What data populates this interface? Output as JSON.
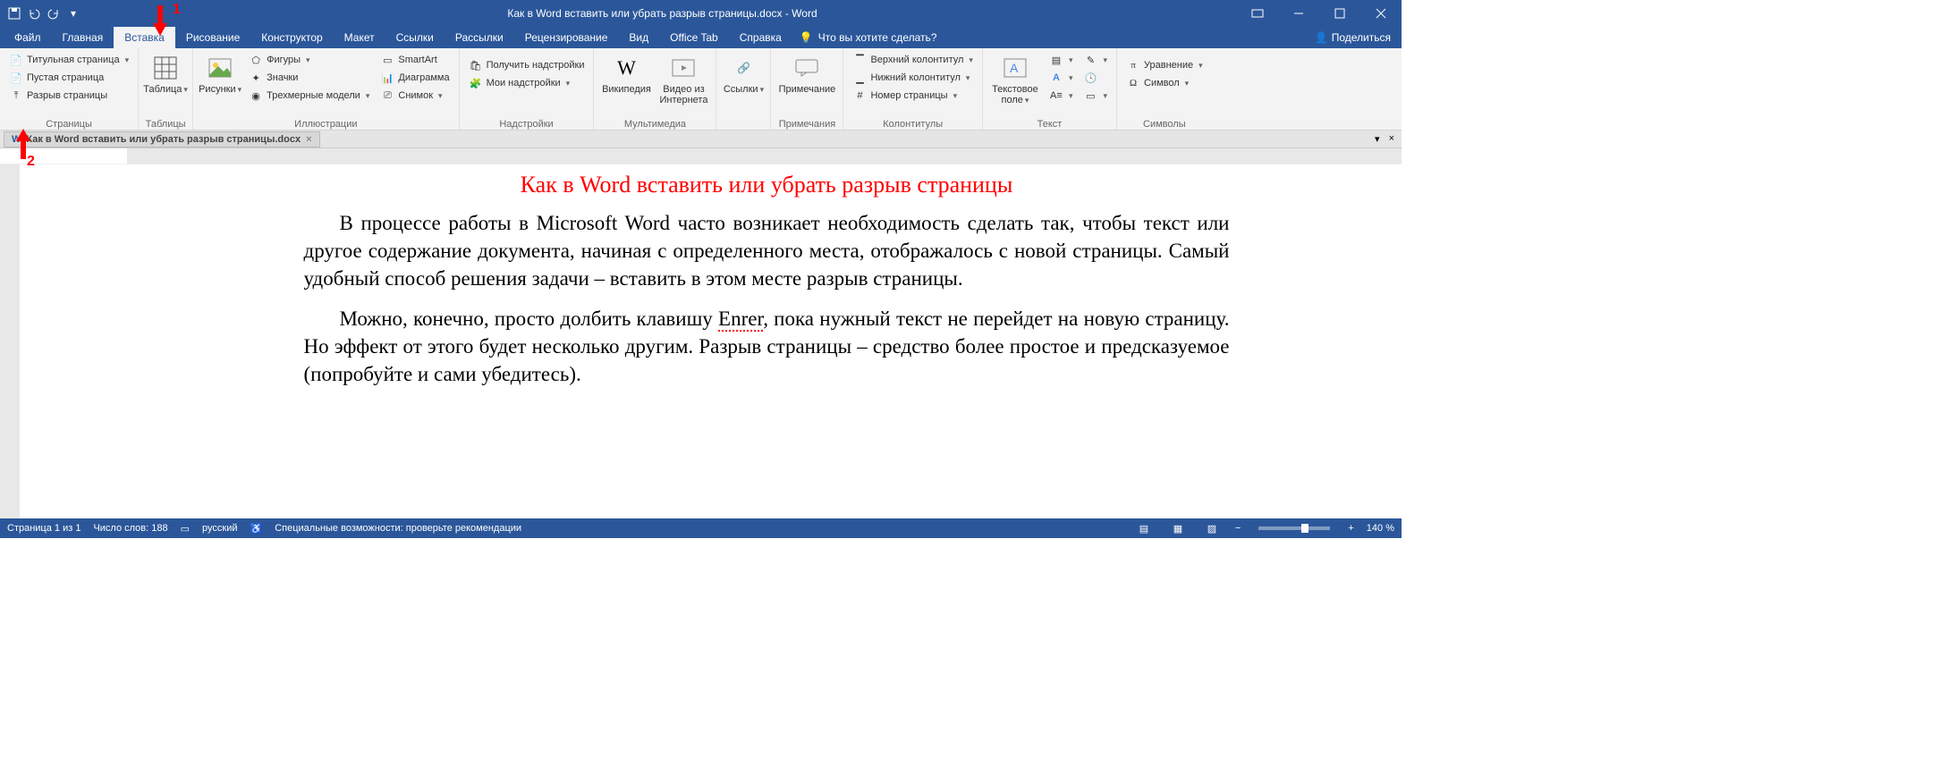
{
  "titlebar": {
    "doc_title": "Как в Word вставить или убрать разрыв страницы.docx  -  Word"
  },
  "tabs": {
    "file": "Файл",
    "home": "Главная",
    "insert": "Вставка",
    "draw": "Рисование",
    "design": "Конструктор",
    "layout": "Макет",
    "references": "Ссылки",
    "mailings": "Рассылки",
    "review": "Рецензирование",
    "view": "Вид",
    "officetab": "Office Tab",
    "help": "Справка",
    "tellme": "Что вы хотите сделать?",
    "share": "Поделиться"
  },
  "ribbon": {
    "pages": {
      "label": "Страницы",
      "cover": "Титульная страница",
      "blank": "Пустая страница",
      "break": "Разрыв страницы"
    },
    "tables": {
      "label": "Таблицы",
      "table": "Таблица"
    },
    "illustrations": {
      "label": "Иллюстрации",
      "pictures": "Рисунки",
      "shapes": "Фигуры",
      "icons": "Значки",
      "models3d": "Трехмерные модели",
      "smartart": "SmartArt",
      "chart": "Диаграмма",
      "screenshot": "Снимок"
    },
    "addins": {
      "label": "Надстройки",
      "get": "Получить надстройки",
      "my": "Мои надстройки"
    },
    "multimedia": {
      "label": "Мультимедиа",
      "wiki": "Википедия",
      "video": "Видео из Интернета"
    },
    "links": {
      "label": "",
      "links": "Ссылки"
    },
    "comments": {
      "label": "Примечания",
      "comment": "Примечание"
    },
    "headerfooter": {
      "label": "Колонтитулы",
      "header": "Верхний колонтитул",
      "footer": "Нижний колонтитул",
      "pagenum": "Номер страницы"
    },
    "text": {
      "label": "Текст",
      "textbox": "Текстовое поле"
    },
    "symbols": {
      "label": "Символы",
      "equation": "Уравнение",
      "symbol": "Символ"
    }
  },
  "doctab": {
    "name": "Как в Word вставить или убрать разрыв страницы.docx"
  },
  "document": {
    "title": "Как в Word вставить или убрать разрыв страницы",
    "p1": "В процессе работы в Microsoft Word часто возникает необходимость сделать так, чтобы текст или другое содержание документа, начиная с определенного места, отображалось с новой страницы. Самый удобный способ решения задачи – вставить в этом месте разрыв страницы.",
    "p2a": "Можно, конечно, просто долбить клавишу ",
    "p2err": "Enrer",
    "p2b": ", пока нужный текст не перейдет на новую страницу. Но эффект от этого будет несколько другим. Разрыв страницы – средство более простое и предсказуемое (попробуйте и сами убедитесь)."
  },
  "statusbar": {
    "page": "Страница 1 из 1",
    "words": "Число слов: 188",
    "lang": "русский",
    "a11y": "Специальные возможности: проверьте рекомендации",
    "zoom": "140 %"
  },
  "annotations": {
    "a1": "1",
    "a2": "2"
  }
}
